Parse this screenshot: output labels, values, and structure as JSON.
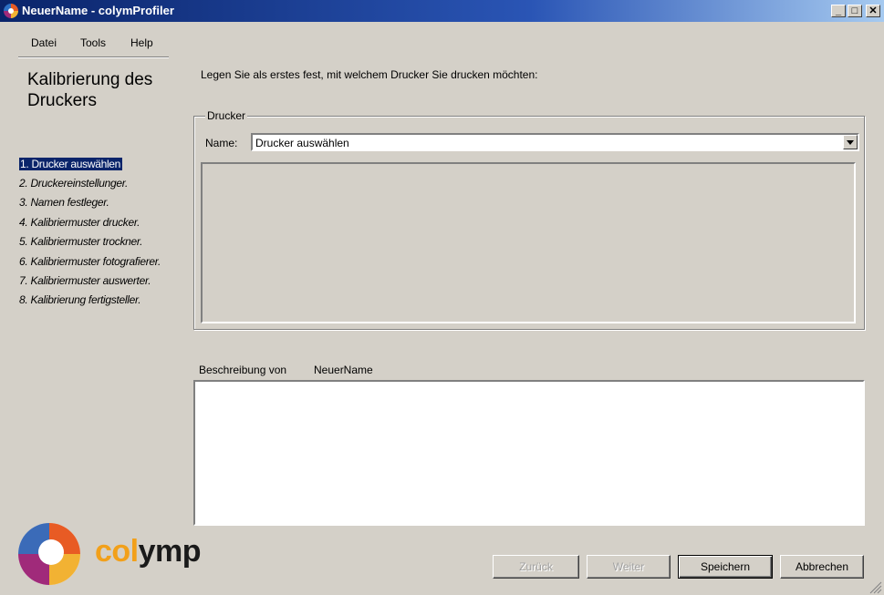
{
  "window": {
    "title": "NeuerName - colymProfiler",
    "minimize_glyph": "_",
    "maximize_glyph": "□",
    "close_glyph": "✕"
  },
  "menu": {
    "items": [
      "Datei",
      "Tools",
      "Help"
    ]
  },
  "sidebar": {
    "title": "Kalibrierung des Druckers",
    "steps": [
      "1. Drucker auswählen",
      "2. Druckereinstellunger.",
      "3. Namen festleger.",
      "4. Kalibriermuster drucker.",
      "5. Kalibriermuster trockner.",
      "6. Kalibriermuster fotografierer.",
      "7. Kalibriermuster auswerter.",
      "8. Kalibrierung fertigsteller."
    ],
    "active_step": 1
  },
  "main": {
    "instruction": "Legen Sie als erstes fest, mit welchem Drucker Sie drucken möchten:",
    "printer_group": {
      "legend": "Drucker",
      "name_label": "Name:",
      "selected_printer": "Drucker auswählen"
    },
    "description": {
      "label": "Beschreibung von",
      "name": "NeuerName",
      "text": ""
    }
  },
  "logo": {
    "text_part1": "col",
    "text_part2": "ymp"
  },
  "buttons": {
    "back": "Zurück",
    "next": "Weiter",
    "save": "Speichern",
    "cancel": "Abbrechen"
  },
  "colors": {
    "titlebar": "#0a246a",
    "background": "#d4d0c8",
    "selection": "#0a246a",
    "logo_accent": "#f2a01a"
  }
}
